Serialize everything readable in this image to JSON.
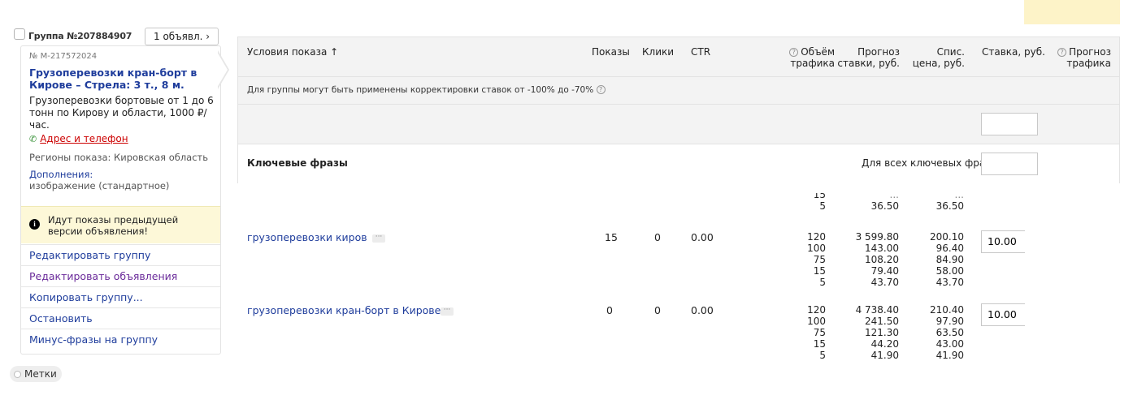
{
  "group": {
    "title": "Группа №207884907",
    "ads_count_label": "1 объявл."
  },
  "ad": {
    "number": "№ М-217572024",
    "title": "Грузоперевозки кран-борт в Кирове – Стрела: 3 т., 8 м.",
    "text": "Грузоперевозки бортовые от 1 до 6 тонн по Кирову и области, 1000 ₽/час.",
    "contact_link": "Адрес и телефон",
    "regions": "Регионы показа: Кировская область",
    "extras_label": "Дополнения:",
    "extras_value": "изображение (стандартное)"
  },
  "notice": {
    "text": "Идут показы предыдущей версии объявления!"
  },
  "actions": [
    {
      "label": "Редактировать группу"
    },
    {
      "label": "Редактировать объявления"
    },
    {
      "label": "Копировать группу..."
    },
    {
      "label": "Остановить"
    },
    {
      "label": "Минус-фразы на группу"
    }
  ],
  "tags_label": "Метки",
  "table": {
    "headers": {
      "conditions": "Условия показа ↑",
      "impressions": "Показы",
      "clicks": "Клики",
      "ctr": "CTR",
      "traffic_volume_l1": "Объём",
      "traffic_volume_l2": "трафика",
      "bid_forecast_l1": "Прогноз",
      "bid_forecast_l2": "ставки, руб.",
      "charged_price_l1": "Спис.",
      "charged_price_l2": "цена, руб.",
      "bid": "Ставка, руб.",
      "forecast_l1": "Прогноз",
      "forecast_l2": "трафика"
    },
    "bid_adjustment_note": "Для группы могут быть применены корректировки ставок от -100% до -70%",
    "group_bid_value": "",
    "keywords_title": "Ключевые фразы",
    "all_keywords_label": "Для всех ключевых фраз:",
    "all_keywords_value": "",
    "partial_row": {
      "volumes": [
        "15",
        "5"
      ],
      "forecasts": [
        "...",
        "36.50"
      ],
      "prices": [
        "...",
        "36.50"
      ]
    },
    "rows": [
      {
        "phrase": "грузоперевозки киров",
        "impressions": "15",
        "clicks": "0",
        "ctr": "0.00",
        "volumes": [
          "120",
          "100",
          "75",
          "15",
          "5"
        ],
        "forecasts": [
          "3 599.80",
          "143.00",
          "108.20",
          "79.40",
          "43.70"
        ],
        "prices": [
          "200.10",
          "96.40",
          "84.90",
          "58.00",
          "43.70"
        ],
        "bid": "10.00"
      },
      {
        "phrase": "грузоперевозки кран-борт в Кирове",
        "impressions": "0",
        "clicks": "0",
        "ctr": "0.00",
        "volumes": [
          "120",
          "100",
          "75",
          "15",
          "5"
        ],
        "forecasts": [
          "4 738.40",
          "241.50",
          "121.30",
          "44.20",
          "41.90"
        ],
        "prices": [
          "210.40",
          "97.90",
          "63.50",
          "43.00",
          "41.90"
        ],
        "bid": "10.00"
      }
    ]
  }
}
